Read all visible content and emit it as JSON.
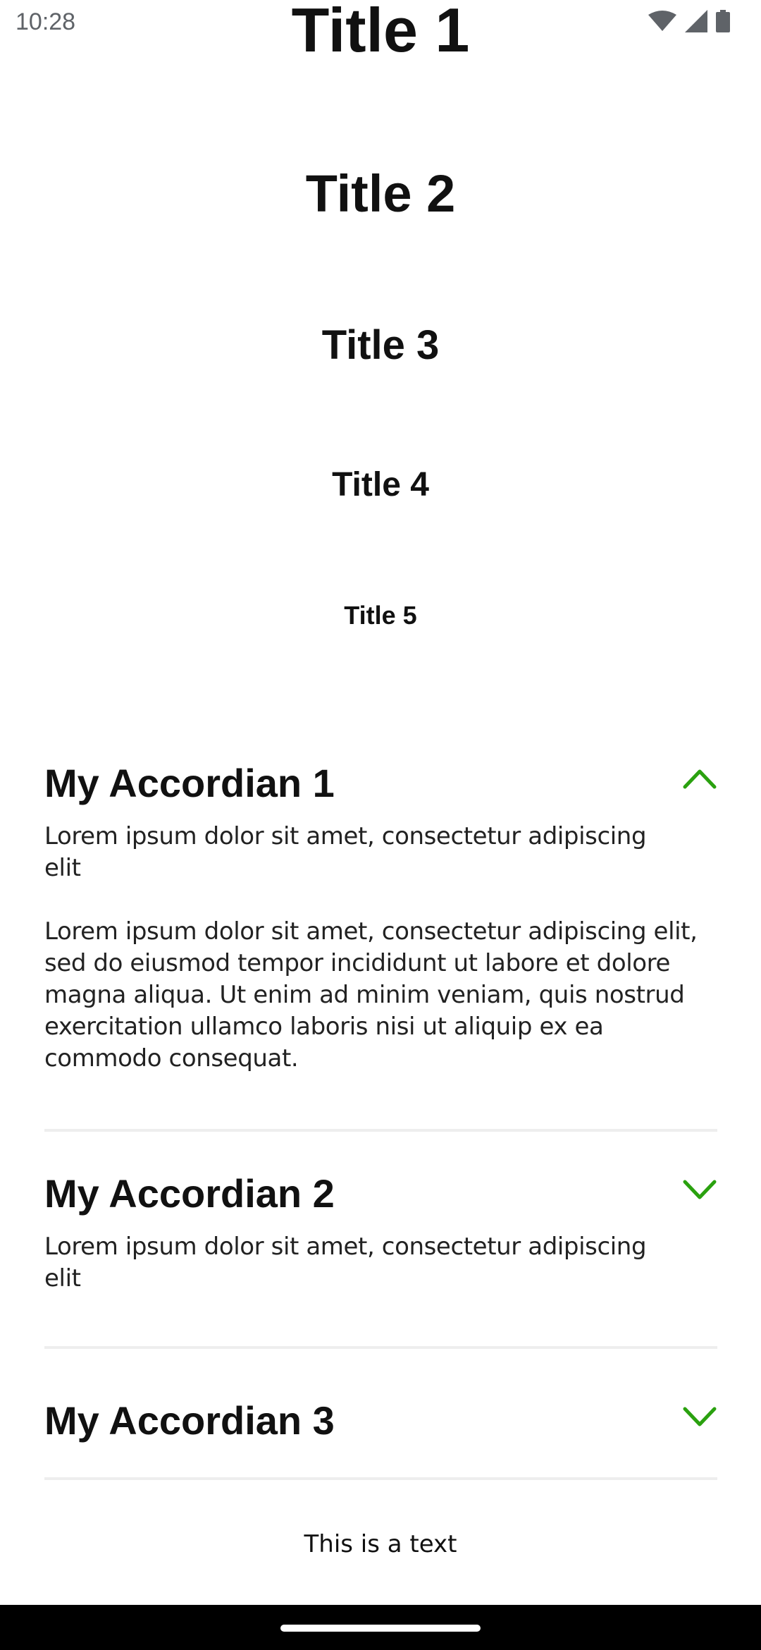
{
  "status_bar": {
    "time": "10:28",
    "icons": [
      "wifi-icon",
      "signal-icon",
      "battery-icon"
    ]
  },
  "titles": {
    "title1": "Title 1",
    "title2": "Title 2",
    "title3": "Title 3",
    "title4": "Title 4",
    "title5": "Title 5"
  },
  "accordions": [
    {
      "title": "My Accordian 1",
      "expanded": true,
      "chevron": "chevron-up-icon",
      "paragraphs": [
        "Lorem ipsum dolor sit amet, consectetur adipiscing elit",
        "Lorem ipsum dolor sit amet, consectetur adipiscing elit, sed do eiusmod tempor incididunt ut labore et dolore magna aliqua. Ut enim ad minim veniam, quis nostrud exercitation ullamco laboris nisi ut aliquip ex ea commodo consequat."
      ]
    },
    {
      "title": "My Accordian 2",
      "expanded": false,
      "chevron": "chevron-down-icon",
      "paragraphs": [
        "Lorem ipsum dolor sit amet, consectetur adipiscing elit"
      ]
    },
    {
      "title": "My Accordian 3",
      "expanded": false,
      "chevron": "chevron-down-icon",
      "paragraphs": []
    }
  ],
  "footer_text": "This is a text",
  "colors": {
    "accent": "#2aa10f",
    "divider": "#eeeeee",
    "nav_bar": "#000000"
  }
}
